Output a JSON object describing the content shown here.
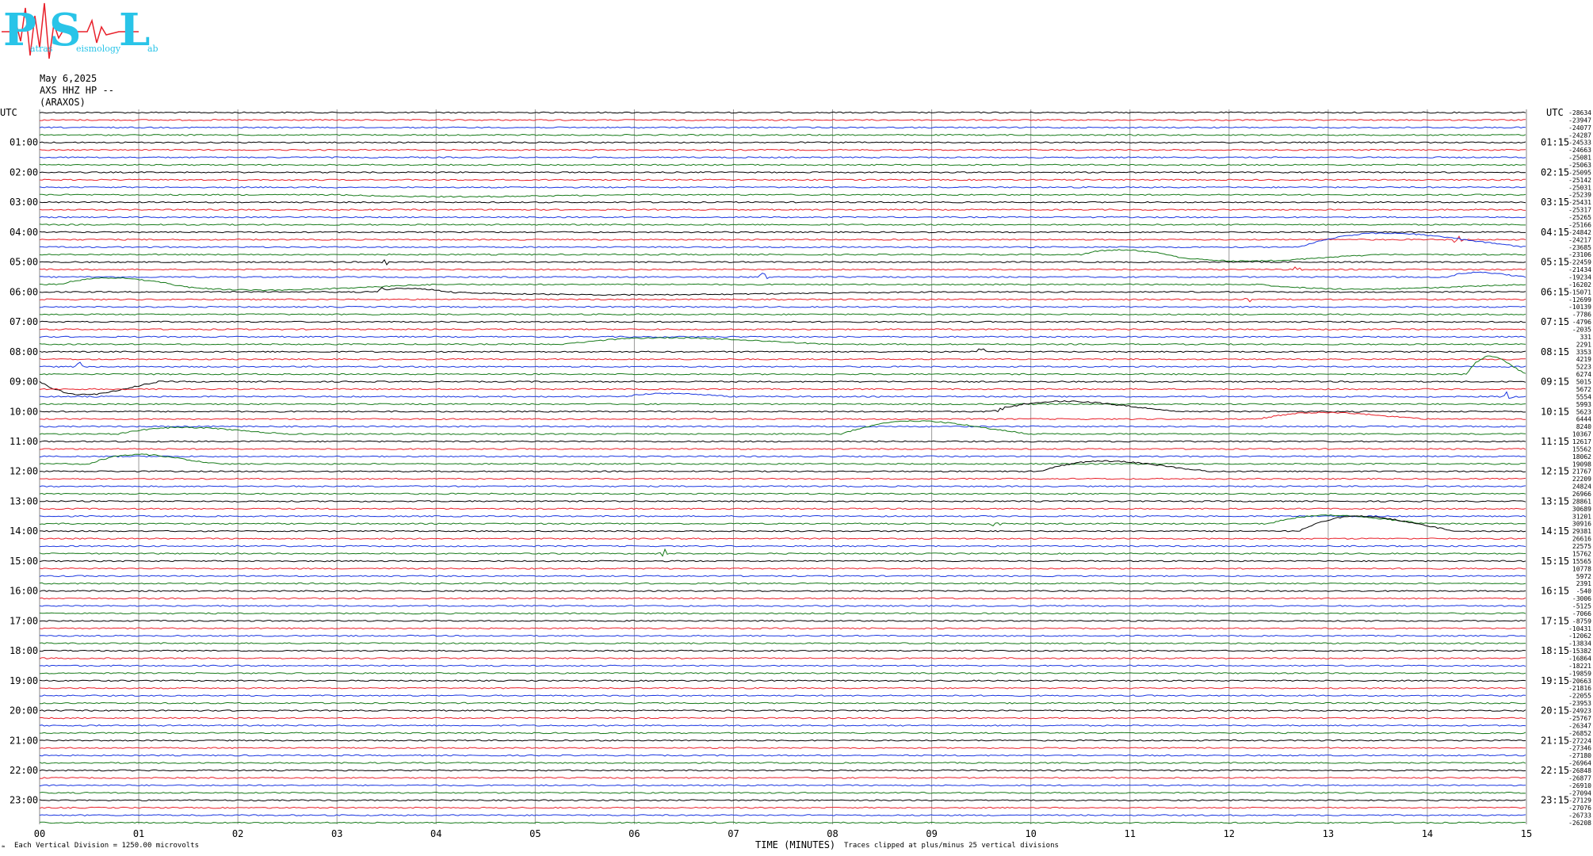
{
  "logo": {
    "letter1": "P",
    "letter2": "S",
    "letter3": "L",
    "sub1": "atras",
    "sub2": "eismology",
    "sub3": "ab",
    "color": "#29c4e8",
    "wave_color": "#e8202a"
  },
  "header": {
    "date": "May 6,2025",
    "station": "AXS HHZ HP --",
    "site": "(ARAXOS)"
  },
  "footer": {
    "scale_note": "Each Vertical Division = 1250.00 microvolts",
    "xaxis_label": "TIME (MINUTES)",
    "clip_note": "Traces clipped at plus/minus 25 vertical divisions",
    "corner_mark": "≈"
  },
  "chart_data": {
    "type": "line",
    "subtype": "helicorder",
    "trace_colors": [
      "#000000",
      "#e8202a",
      "#1a36e0",
      "#177a1a"
    ],
    "grid": true,
    "xlim": [
      0,
      15
    ],
    "x_ticks": [
      "00",
      "01",
      "02",
      "03",
      "04",
      "05",
      "06",
      "07",
      "08",
      "09",
      "10",
      "11",
      "12",
      "13",
      "14",
      "15"
    ],
    "left_axis_title": "UTC",
    "right_axis_title": "UTC",
    "left_hour_labels": [
      "01:00",
      "02:00",
      "03:00",
      "04:00",
      "05:00",
      "06:00",
      "07:00",
      "08:00",
      "09:00",
      "10:00",
      "11:00",
      "12:00",
      "13:00",
      "14:00",
      "15:00",
      "16:00",
      "17:00",
      "18:00",
      "19:00",
      "20:00",
      "21:00",
      "22:00",
      "23:00"
    ],
    "right_hour_labels": [
      "01:15",
      "02:15",
      "03:15",
      "04:15",
      "05:15",
      "06:15",
      "07:15",
      "08:15",
      "09:15",
      "10:15",
      "11:15",
      "12:15",
      "13:15",
      "14:15",
      "15:15",
      "16:15",
      "17:15",
      "18:15",
      "19:15",
      "20:15",
      "21:15",
      "22:15",
      "23:15"
    ],
    "trace_count": 96,
    "row_offsets": [
      "-28634",
      "-23947",
      "-24077",
      "-24287",
      "-24533",
      "-24663",
      "-25081",
      "-25063",
      "-25095",
      "-25142",
      "-25031",
      "-25239",
      "-25431",
      "-25317",
      "-25265",
      "-25166",
      "-24842",
      "-24217",
      "-23685",
      "-23106",
      "-22459",
      "-21434",
      "-19234",
      "-16202",
      "-15071",
      "-12699",
      "-10139",
      "-7786",
      "-4796",
      "-2035",
      "331",
      "2291",
      "3353",
      "4219",
      "5223",
      "6274",
      "5015",
      "5672",
      "5554",
      "5993",
      "5623",
      "6444",
      "8240",
      "10367",
      "12617",
      "15562",
      "18062",
      "19098",
      "21767",
      "22209",
      "24824",
      "26966",
      "28861",
      "30689",
      "31201",
      "30916",
      "29381",
      "26616",
      "22575",
      "15762",
      "15565",
      "10778",
      "5972",
      "2391",
      "-540",
      "-3006",
      "-5125",
      "-7066",
      "-8759",
      "-10431",
      "-12062",
      "-13834",
      "-15382",
      "-16864",
      "-18221",
      "-19859",
      "-20663",
      "-21816",
      "-22055",
      "-23953",
      "-24923",
      "-25767",
      "-26347",
      "-26852",
      "-27224",
      "-27346",
      "-27180",
      "-26964",
      "-26848",
      "-26877",
      "-26910",
      "-27094",
      "-27129",
      "-27076",
      "-26733",
      "-26208"
    ],
    "events": [
      {
        "trace": 17,
        "minute": 14.3
      },
      {
        "trace": 20,
        "minute": 3.5
      },
      {
        "trace": 21,
        "minute": 12.7
      },
      {
        "trace": 22,
        "minute": 7.3
      },
      {
        "trace": 24,
        "minute": 3.45
      },
      {
        "trace": 25,
        "minute": 12.2
      },
      {
        "trace": 32,
        "minute": 9.5
      },
      {
        "trace": 34,
        "minute": 0.4
      },
      {
        "trace": 38,
        "minute": 14.8
      },
      {
        "trace": 40,
        "minute": 9.7
      },
      {
        "trace": 55,
        "minute": 9.65
      },
      {
        "trace": 59,
        "minute": 6.3
      }
    ],
    "humps": [
      {
        "trace": 11,
        "start": 3.0,
        "end": 6.0,
        "amp": -4
      },
      {
        "trace": 19,
        "start": 10.5,
        "end": 11.5,
        "amp": 10
      },
      {
        "trace": 19,
        "start": 11.3,
        "end": 13.5,
        "amp": -14
      },
      {
        "trace": 18,
        "start": 12.7,
        "end": 15.0,
        "amp": 30
      },
      {
        "trace": 22,
        "start": 14.2,
        "end": 15.0,
        "amp": 10
      },
      {
        "trace": 23,
        "start": 0.2,
        "end": 1.5,
        "amp": 14
      },
      {
        "trace": 23,
        "start": 1.2,
        "end": 4.0,
        "amp": -12
      },
      {
        "trace": 23,
        "start": 12.3,
        "end": 15.0,
        "amp": -10
      },
      {
        "trace": 24,
        "start": 3.4,
        "end": 4.2,
        "amp": 8
      },
      {
        "trace": 24,
        "start": 4.0,
        "end": 9.0,
        "amp": -6
      },
      {
        "trace": 31,
        "start": 5.3,
        "end": 8.0,
        "amp": 14
      },
      {
        "trace": 35,
        "start": 14.4,
        "end": 15.0,
        "amp": 38
      },
      {
        "trace": 36,
        "start": 0.0,
        "end": 1.2,
        "amp": -28
      },
      {
        "trace": 38,
        "start": 5.9,
        "end": 7.0,
        "amp": 7
      },
      {
        "trace": 40,
        "start": 9.6,
        "end": 11.5,
        "amp": 22
      },
      {
        "trace": 41,
        "start": 12.3,
        "end": 14.0,
        "amp": 14
      },
      {
        "trace": 43,
        "start": 0.8,
        "end": 2.5,
        "amp": 14
      },
      {
        "trace": 43,
        "start": 8.1,
        "end": 10.0,
        "amp": 28
      },
      {
        "trace": 47,
        "start": 0.5,
        "end": 1.8,
        "amp": 20
      },
      {
        "trace": 48,
        "start": 10.1,
        "end": 11.8,
        "amp": 22
      },
      {
        "trace": 55,
        "start": 12.4,
        "end": 14.0,
        "amp": 18
      },
      {
        "trace": 56,
        "start": 12.7,
        "end": 14.3,
        "amp": 32
      }
    ]
  }
}
